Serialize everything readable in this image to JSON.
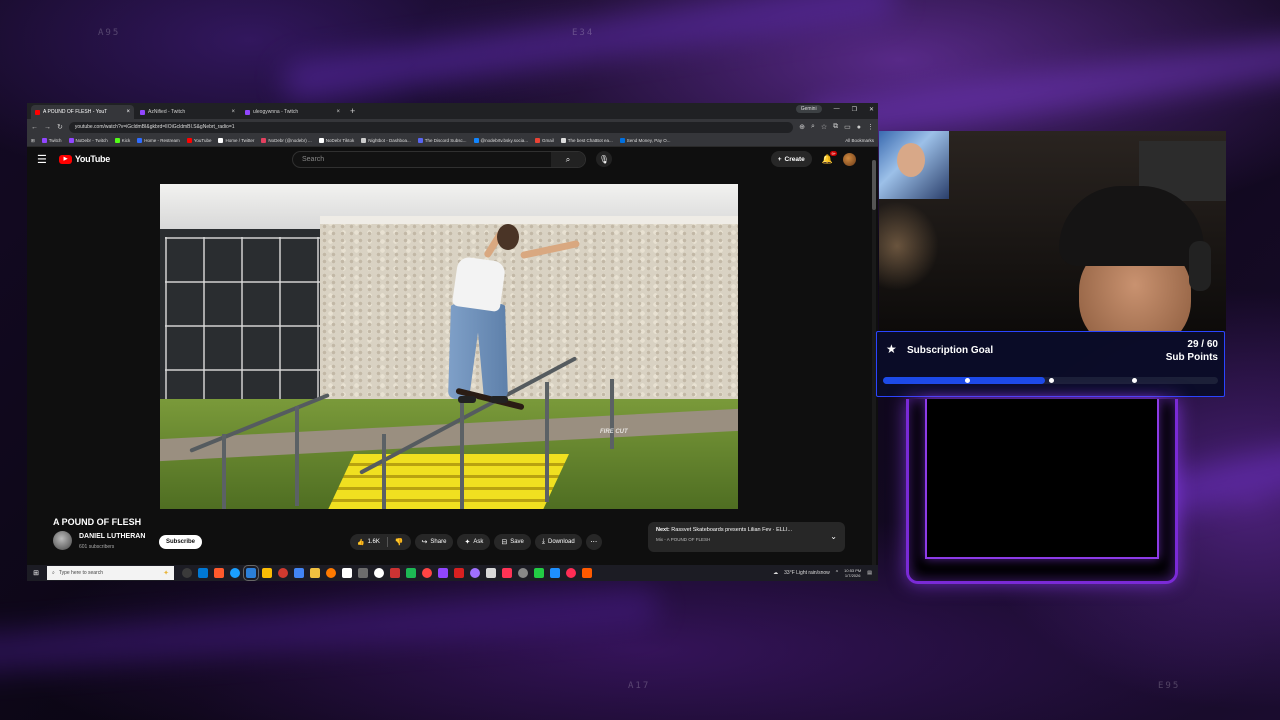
{
  "overlay": {
    "codes": [
      "A95",
      "E34",
      "A17",
      "E95"
    ]
  },
  "browser": {
    "tabs": [
      {
        "title": "A POUND OF FLESH - YouT",
        "active": true,
        "color": "#ff0000"
      },
      {
        "title": "AzNified - Twitch",
        "active": false,
        "color": "#9146ff"
      },
      {
        "title": "uleogywnna - Twitch",
        "active": false,
        "color": "#9146ff"
      }
    ],
    "gemini_label": "Gemini",
    "url": "youtube.com/watch?v=iGcldmBI&gkbrd=lIOiGcldmBI.S&gNebrt_radio=1",
    "bookmarks": [
      {
        "label": "Twitch",
        "color": "#9146ff"
      },
      {
        "label": "NoDebr - Twitch",
        "color": "#9146ff"
      },
      {
        "label": "Kick",
        "color": "#53fc18"
      },
      {
        "label": "Home - Restream",
        "color": "#2f6cff"
      },
      {
        "label": "YouTube",
        "color": "#ff0000"
      },
      {
        "label": "Home / Twitter",
        "color": "#ffffff"
      },
      {
        "label": "NoDebr (@nodebr) ...",
        "color": "#e4405f"
      },
      {
        "label": "NoDebr Tiktok",
        "color": "#ffffff"
      },
      {
        "label": "Nightbot - Dashboa...",
        "color": "#cccccc"
      },
      {
        "label": "The Discord Subsc...",
        "color": "#5865f2"
      },
      {
        "label": "@nodebrtv.bsky.socia...",
        "color": "#1185fe"
      },
      {
        "label": "Gmail",
        "color": "#ea4335"
      },
      {
        "label": "The best ChatBot ea...",
        "color": "#dddddd"
      },
      {
        "label": "Send Money, Pay O...",
        "color": "#0070e0"
      }
    ],
    "all_bookmarks": "All Bookmarks"
  },
  "youtube": {
    "logo_text": "YouTube",
    "search_placeholder": "Search",
    "create_label": "Create",
    "notif_count": "9+",
    "video_watermark": "FIRE CUT",
    "video_title": "A POUND OF FLESH",
    "channel_name": "DANIEL LUTHERAN",
    "channel_subs": "601 subscribers",
    "subscribe_label": "Subscribe",
    "like_count": "1.6K",
    "share_label": "Share",
    "ask_label": "Ask",
    "save_label": "Save",
    "download_label": "Download",
    "next_prefix": "Next:",
    "next_title": "Rassvet Skateboards presents Lilian Fev · ELLI...",
    "next_sub": "Mix - A POUND OF FLESH"
  },
  "taskbar": {
    "search_placeholder": "Type here to search",
    "apps": [
      "#3a3a3a",
      "#0078d4",
      "#ff5a2c",
      "#1a9fff",
      "#2b7fd8",
      "#fbbc05",
      "#d03a2f",
      "#4285f4",
      "#f0c040",
      "#ff7a00",
      "#ffffff",
      "#6d6d6d",
      "#ffffff",
      "#c33",
      "#1db954",
      "#ff4444",
      "#9146ff",
      "#d82020",
      "#a070ff",
      "#d8d8d8",
      "#ff3355",
      "#888888",
      "#22cc44",
      "#1e90ff",
      "#ff2d55",
      "#ff5a00"
    ],
    "weather": "33°F  Light rain/snow",
    "time": "10:53 PM",
    "date": "1/7/2026"
  },
  "goal": {
    "title": "Subscription Goal",
    "count": "29 / 60",
    "unit": "Sub Points",
    "current": 29,
    "target": 60,
    "fill_color": "#1d4be8",
    "milestones": [
      0.25,
      0.5,
      0.75
    ]
  }
}
